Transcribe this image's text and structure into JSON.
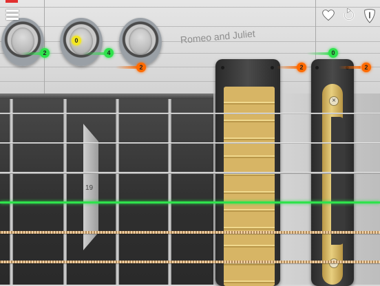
{
  "song": {
    "title": "Romeo and Juliet"
  },
  "toolbar": {
    "menu_icon": "hamburger-menu-icon",
    "favorite_icon": "heart-icon",
    "restart_icon": "restart-icon",
    "pick_icon": "guitar-pick-icon"
  },
  "fretboard": {
    "fret_number": "19"
  },
  "notes": [
    {
      "label": "2",
      "color": "green"
    },
    {
      "label": "0",
      "color": "yellow"
    },
    {
      "label": "4",
      "color": "green"
    },
    {
      "label": "2",
      "color": "orange"
    },
    {
      "label": "0",
      "color": "green"
    },
    {
      "label": "2",
      "color": "orange"
    },
    {
      "label": "2",
      "color": "orange"
    }
  ],
  "colors": {
    "green_note": "#2fe24c",
    "yellow_note": "#f2e622",
    "orange_note": "#ff6a00",
    "active_string": "#2fe24c",
    "pickup_gold": "#d7b565"
  }
}
